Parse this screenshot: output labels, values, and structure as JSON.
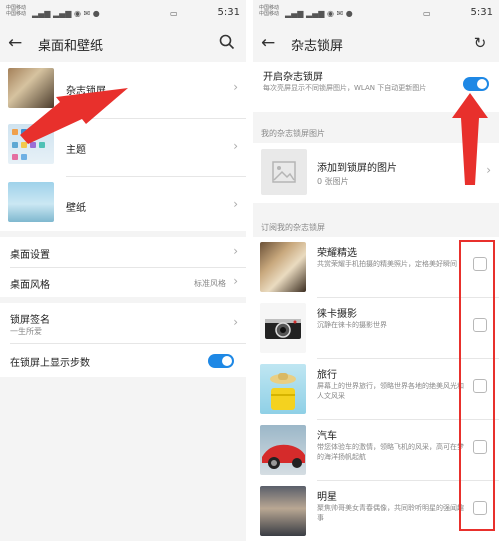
{
  "status_bar": {
    "carrier_left": "中国移动\n中国移动",
    "time_left": "5:31",
    "carrier_right": "中国移动\n中国移动",
    "time_right": "5:31"
  },
  "left_panel": {
    "title": "桌面和壁纸",
    "items": [
      {
        "label": "杂志锁屏"
      },
      {
        "label": "主题"
      },
      {
        "label": "壁纸"
      }
    ],
    "settings": [
      {
        "label": "桌面设置"
      },
      {
        "label": "桌面风格",
        "value": "标准风格"
      }
    ],
    "signature": {
      "label": "锁屏签名",
      "sub": "一生所爱"
    },
    "steps": {
      "label": "在锁屏上显示步数",
      "enabled": true
    }
  },
  "right_panel": {
    "title": "杂志锁屏",
    "toggle": {
      "label": "开启杂志锁屏",
      "desc": "每次亮屏显示不同锁屏图片，WLAN 下自动更新图片",
      "enabled": true
    },
    "my_section": "我的杂志锁屏图片",
    "add": {
      "label": "添加到锁屏的图片",
      "count": "0 张图片"
    },
    "subscribed_section": "订阅我的杂志锁屏",
    "subscriptions": [
      {
        "title": "荣耀精选",
        "desc": "共赏荣耀手机拍摄的精美照片，定格美好瞬间"
      },
      {
        "title": "徕卡摄影",
        "desc": "沉静在徕卡的摄影世界"
      },
      {
        "title": "旅行",
        "desc": "屏幕上的世界旅行，领略世界各地的绝美风光和人文风采"
      },
      {
        "title": "汽车",
        "desc": "带您体验车的激情，领略飞机的风采，高可在梦的海洋扬帆起航"
      },
      {
        "title": "明星",
        "desc": "聚焦帅哥美女青春偶像，共同聆听明星的强闻趣事"
      }
    ]
  },
  "colors": {
    "accent": "#1e88e5",
    "annotation": "#e8302c"
  }
}
